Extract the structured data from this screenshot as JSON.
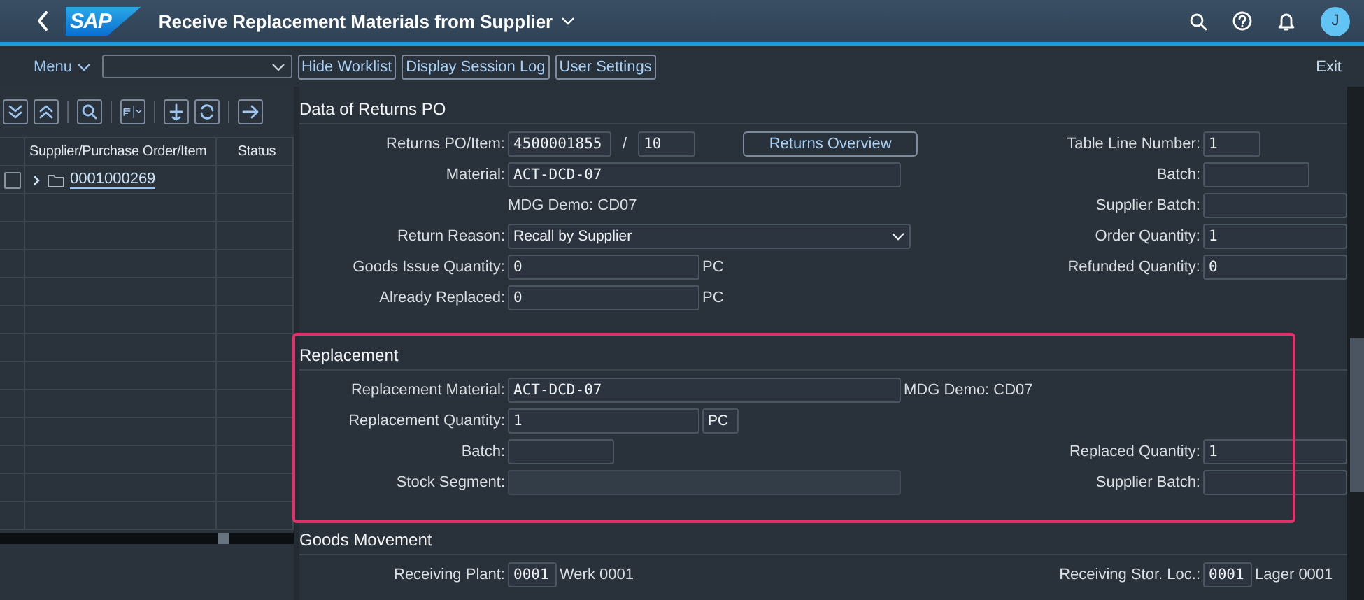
{
  "header": {
    "logo": "SAP",
    "title": "Receive Replacement Materials from Supplier",
    "avatar": "J"
  },
  "toolbar": {
    "menu": "Menu",
    "buttons": [
      "Hide Worklist",
      "Display Session Log",
      "User Settings"
    ],
    "exit": "Exit"
  },
  "worklist": {
    "columns": [
      "Supplier/Purchase Order/Item",
      "Status"
    ],
    "rows": [
      {
        "id": "0001000269",
        "expanded": false,
        "checked": false
      }
    ]
  },
  "sections": [
    {
      "title": "Data of Returns PO",
      "highlighted": false,
      "rows": [
        {
          "left": {
            "kind": "pair",
            "label": "Returns PO/Item:",
            "values": [
              "4500001855",
              "10"
            ],
            "separator": "/",
            "button": "Returns Overview"
          },
          "right": {
            "kind": "tiny",
            "label": "Table Line Number:",
            "value": "1"
          }
        },
        {
          "left": {
            "kind": "long",
            "label": "Material:",
            "value": "ACT-DCD-07",
            "disabled": false
          },
          "right": {
            "kind": "short",
            "label": "Batch:"
          }
        },
        {
          "left": {
            "kind": "text",
            "value": "MDG Demo: CD07"
          },
          "right": {
            "kind": "wide",
            "label": "Supplier Batch:"
          }
        },
        {
          "left": {
            "kind": "dropdown",
            "label": "Return Reason:",
            "value": "Recall by Supplier"
          },
          "right": {
            "kind": "wide",
            "label": "Order Quantity:",
            "value": "1"
          }
        },
        {
          "left": {
            "kind": "qty",
            "label": "Goods Issue Quantity:",
            "value": "0",
            "unit": "PC",
            "unit_field": false
          },
          "right": {
            "kind": "wide",
            "label": "Refunded Quantity:",
            "value": "0"
          }
        },
        {
          "left": {
            "kind": "qty",
            "label": "Already Replaced:",
            "value": "0",
            "unit": "PC",
            "unit_field": false
          }
        }
      ]
    },
    {
      "title": "Replacement",
      "highlighted": true,
      "rows": [
        {
          "left": {
            "kind": "long",
            "label": "Replacement Material:",
            "value": "ACT-DCD-07",
            "suffix": "MDG Demo: CD07",
            "disabled": false
          }
        },
        {
          "left": {
            "kind": "qty",
            "label": "Replacement Quantity:",
            "value": "1",
            "unit": "PC",
            "unit_field": true
          }
        },
        {
          "left": {
            "kind": "short",
            "label": "Batch:"
          },
          "right": {
            "kind": "wide",
            "label": "Replaced Quantity:",
            "value": "1"
          }
        },
        {
          "left": {
            "kind": "long",
            "label": "Stock Segment:",
            "disabled": true
          },
          "right": {
            "kind": "wide",
            "label": "Supplier Batch:"
          }
        }
      ]
    },
    {
      "title": "Goods Movement",
      "highlighted": false,
      "rows": [
        {
          "left": {
            "kind": "code",
            "label": "Receiving Plant:",
            "value": "0001",
            "description": "Werk 0001"
          },
          "right": {
            "kind": "code",
            "label": "Receiving Stor. Loc.:",
            "value": "0001",
            "description": "Lager 0001"
          }
        }
      ]
    }
  ]
}
